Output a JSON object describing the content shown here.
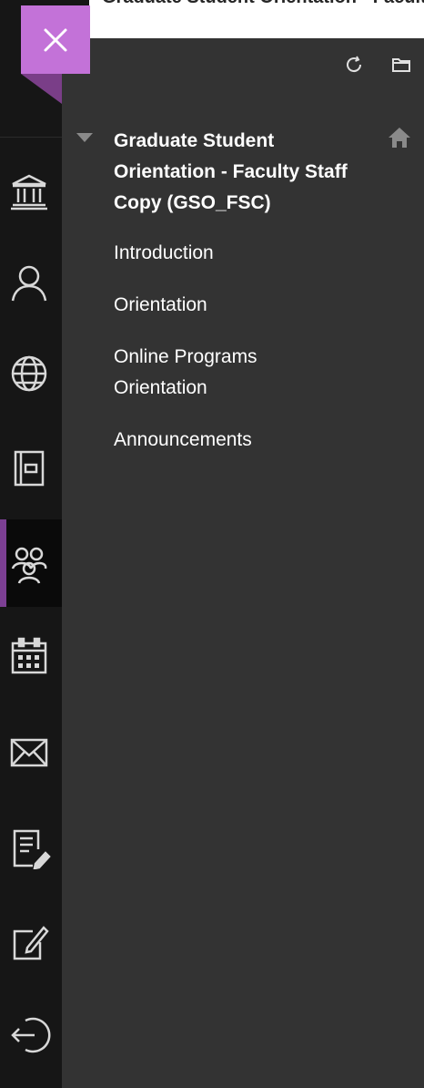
{
  "header": {
    "title": "Graduate Student Orientation - Faculty Staff Copy (GSO_FSC)"
  },
  "colors": {
    "accent": "#c372d8",
    "accent_dark": "#7a3e88",
    "rail_active": "#7c3f93",
    "panel_bg": "#333333",
    "rail_bg": "#161616"
  },
  "rail": {
    "items": [
      {
        "icon": "institution-icon"
      },
      {
        "icon": "profile-icon"
      },
      {
        "icon": "globe-icon"
      },
      {
        "icon": "courses-icon"
      },
      {
        "icon": "organizations-icon",
        "active": true
      },
      {
        "icon": "calendar-icon"
      },
      {
        "icon": "messages-icon"
      },
      {
        "icon": "grades-icon"
      },
      {
        "icon": "tools-icon"
      },
      {
        "icon": "sign-out-icon"
      }
    ]
  },
  "toolbar": {
    "icons": [
      "refresh-icon",
      "folder-icon"
    ]
  },
  "course_menu": {
    "course_title": "Graduate Student Orientation - Faculty Staff Copy (GSO_FSC)",
    "links": [
      {
        "label": "Introduction"
      },
      {
        "label": "Orientation"
      },
      {
        "label": "Online Programs Orientation"
      },
      {
        "label": "Announcements"
      }
    ]
  }
}
